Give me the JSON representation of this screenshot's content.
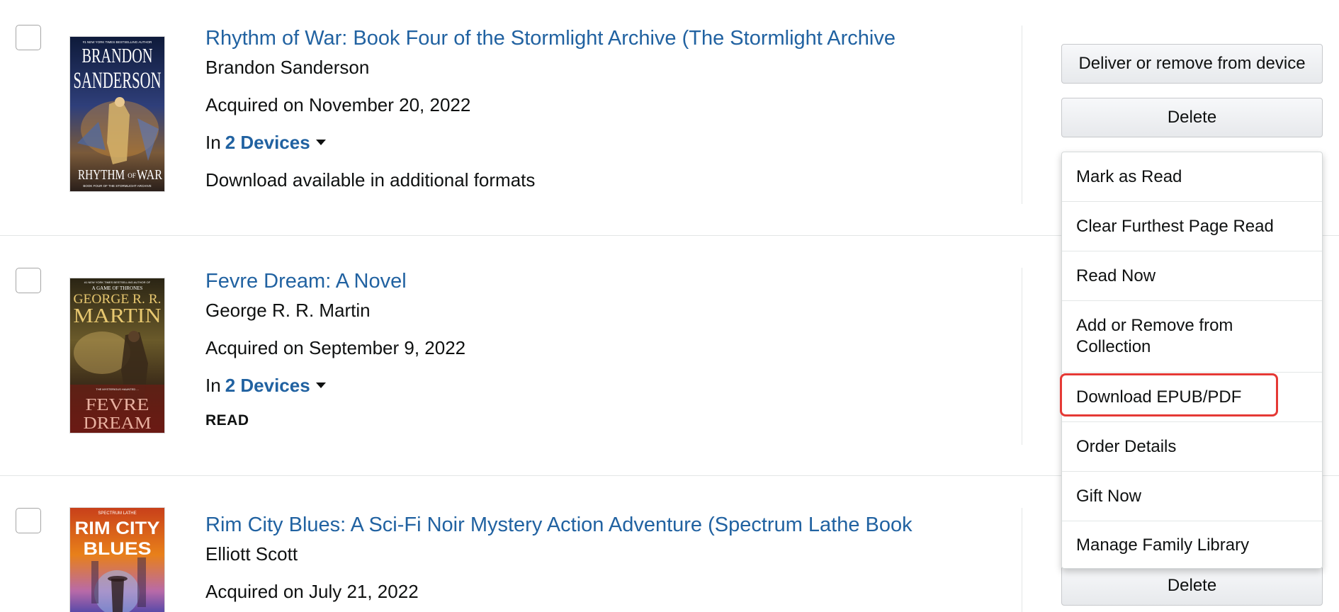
{
  "books": [
    {
      "title": "Rhythm of War: Book Four of the Stormlight Archive (The Stormlight Archive",
      "author": "Brandon Sanderson",
      "acquired": "Acquired on November 20, 2022",
      "devices_prefix": "In",
      "devices_link": "2 Devices",
      "extra": "Download available in additional formats",
      "cover": {
        "top_text": "#1 NEW YORK TIMES BESTSELLING AUTHOR",
        "author_line1": "BRANDON",
        "author_line2": "SANDERSON",
        "title_main": "RHYTHM",
        "title_of": "OF",
        "title_end": "WAR",
        "bottom_text": "BOOK FOUR OF THE STORMLIGHT ARCHIVE"
      }
    },
    {
      "title": "Fevre Dream: A Novel",
      "author": "George R. R. Martin",
      "acquired": "Acquired on September 9, 2022",
      "devices_prefix": "In",
      "devices_link": "2 Devices",
      "status": "READ",
      "cover": {
        "top_text": "#1 NEW YORK TIMES BESTSELLING AUTHOR OF",
        "series_text": "A GAME OF THRONES",
        "author_line1": "GEORGE R. R.",
        "author_line2": "MARTIN",
        "tagline": "THE MYSTERIOUS HAUNTED ...",
        "title_line1": "FEVRE",
        "title_line2": "DREAM"
      }
    },
    {
      "title": "Rim City Blues: A Sci-Fi Noir Mystery Action Adventure (Spectrum Lathe Book",
      "author": "Elliott Scott",
      "acquired": "Acquired on July 21, 2022",
      "cover": {
        "top_text": "SPECTRUM LATHE",
        "title_line1": "RIM CITY",
        "title_line2": "BLUES"
      }
    }
  ],
  "actions": {
    "deliver_label": "Deliver or remove from device",
    "delete_label": "Delete",
    "delete_label_bottom": "Delete"
  },
  "menu": {
    "items": [
      "Mark as Read",
      "Clear Furthest Page Read",
      "Read Now",
      "Add or Remove from Collection",
      "Download EPUB/PDF",
      "Order Details",
      "Gift Now",
      "Manage Family Library"
    ],
    "highlighted_index": 4
  },
  "colors": {
    "link": "#2162a1",
    "highlight": "#e53935"
  }
}
